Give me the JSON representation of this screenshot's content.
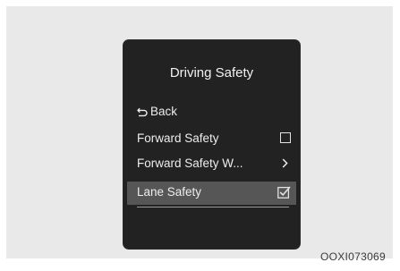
{
  "menu": {
    "title": "Driving Safety",
    "back_label": "Back",
    "items": [
      {
        "label": "Forward Safety",
        "control": "checkbox",
        "checked": false
      },
      {
        "label": "Forward Safety W...",
        "control": "submenu"
      },
      {
        "label": "Lane Safety",
        "control": "checkbox",
        "checked": true,
        "selected": true
      }
    ]
  },
  "caption": "OOXI073069",
  "colors": {
    "screen_bg": "#222222",
    "highlight_bg": "#565656",
    "text": "#ededed",
    "frame_bg": "#e9e9e9"
  },
  "icons": {
    "back": "back-arrow-icon",
    "checkbox_off": "checkbox-unchecked-icon",
    "checkbox_on": "checkbox-checked-icon",
    "submenu": "chevron-right-icon"
  }
}
